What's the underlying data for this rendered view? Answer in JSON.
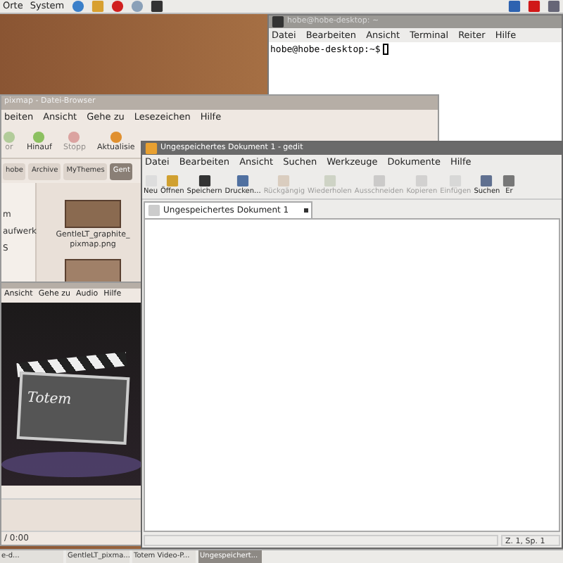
{
  "top_panel": {
    "menus": [
      "Orte",
      "System"
    ]
  },
  "terminal": {
    "title": "hobe@hobe-desktop: ~",
    "menu": [
      "Datei",
      "Bearbeiten",
      "Ansicht",
      "Terminal",
      "Reiter",
      "Hilfe"
    ],
    "prompt": "hobe@hobe-desktop:~$"
  },
  "file_browser": {
    "title": "pixmap - Datei-Browser",
    "menu": [
      "beiten",
      "Ansicht",
      "Gehe zu",
      "Lesezeichen",
      "Hilfe"
    ],
    "toolbar": [
      {
        "label": "or",
        "disabled": true
      },
      {
        "label": "Hinauf",
        "disabled": false
      },
      {
        "label": "Stopp",
        "disabled": true
      },
      {
        "label": "Aktualisie",
        "disabled": false
      }
    ],
    "path": [
      {
        "label": "hobe",
        "selected": false
      },
      {
        "label": "Archive",
        "selected": false
      },
      {
        "label": "MyThemes",
        "selected": false
      },
      {
        "label": "Gent",
        "selected": true
      }
    ],
    "sidebar": [
      "m",
      "aufwerk",
      "S"
    ],
    "files": [
      {
        "name": "GentleLT_graphite_ pixmap.png"
      }
    ]
  },
  "totem": {
    "menu": [
      "Ansicht",
      "Gehe zu",
      "Audio",
      "Hilfe"
    ],
    "logo_text": "Totem",
    "time": "/ 0:00"
  },
  "gedit": {
    "title": "Ungespeichertes Dokument 1 - gedit",
    "menu": [
      "Datei",
      "Bearbeiten",
      "Ansicht",
      "Suchen",
      "Werkzeuge",
      "Dokumente",
      "Hilfe"
    ],
    "toolbar": [
      {
        "label": "Neu",
        "disabled": false
      },
      {
        "label": "Öffnen",
        "disabled": false
      },
      {
        "label": "Speichern",
        "disabled": false
      },
      {
        "label": "Drucken...",
        "disabled": false
      },
      {
        "label": "Rückgängig",
        "disabled": true
      },
      {
        "label": "Wiederholen",
        "disabled": true
      },
      {
        "label": "Ausschneiden",
        "disabled": true
      },
      {
        "label": "Kopieren",
        "disabled": true
      },
      {
        "label": "Einfügen",
        "disabled": true
      },
      {
        "label": "Suchen",
        "disabled": false
      },
      {
        "label": "Er",
        "disabled": false
      }
    ],
    "tab": "Ungespeichertes Dokument 1",
    "status": "Z. 1, Sp. 1"
  },
  "taskbar": [
    {
      "label": "e-d...",
      "selected": false
    },
    {
      "label": "GentleLT_pixma...",
      "selected": false
    },
    {
      "label": "Totem Video-P...",
      "selected": false
    },
    {
      "label": "Ungespeichert...",
      "selected": true
    }
  ]
}
